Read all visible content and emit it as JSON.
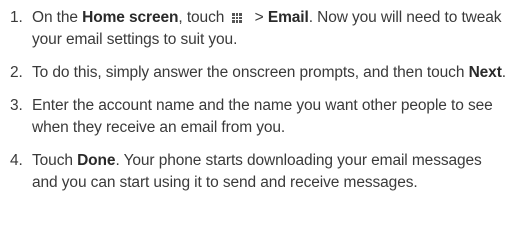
{
  "steps": [
    {
      "number": "1.",
      "text_a": "On the ",
      "bold_a": "Home screen",
      "text_b": ", touch ",
      "icon": "app-grid-icon",
      "text_c": " > ",
      "bold_b": "Email",
      "text_d": ". Now you will need to tweak your email settings to suit you."
    },
    {
      "number": "2.",
      "text_a": "To do this, simply answer the onscreen prompts, and then touch ",
      "bold_a": "Next",
      "text_b": "."
    },
    {
      "number": "3.",
      "text_a": "Enter the account name and the name you want other people to see when they receive an email from you."
    },
    {
      "number": "4.",
      "text_a": "Touch ",
      "bold_a": "Done",
      "text_b": ". Your phone starts downloading your email messages and you can start using it to send and receive messages."
    }
  ]
}
